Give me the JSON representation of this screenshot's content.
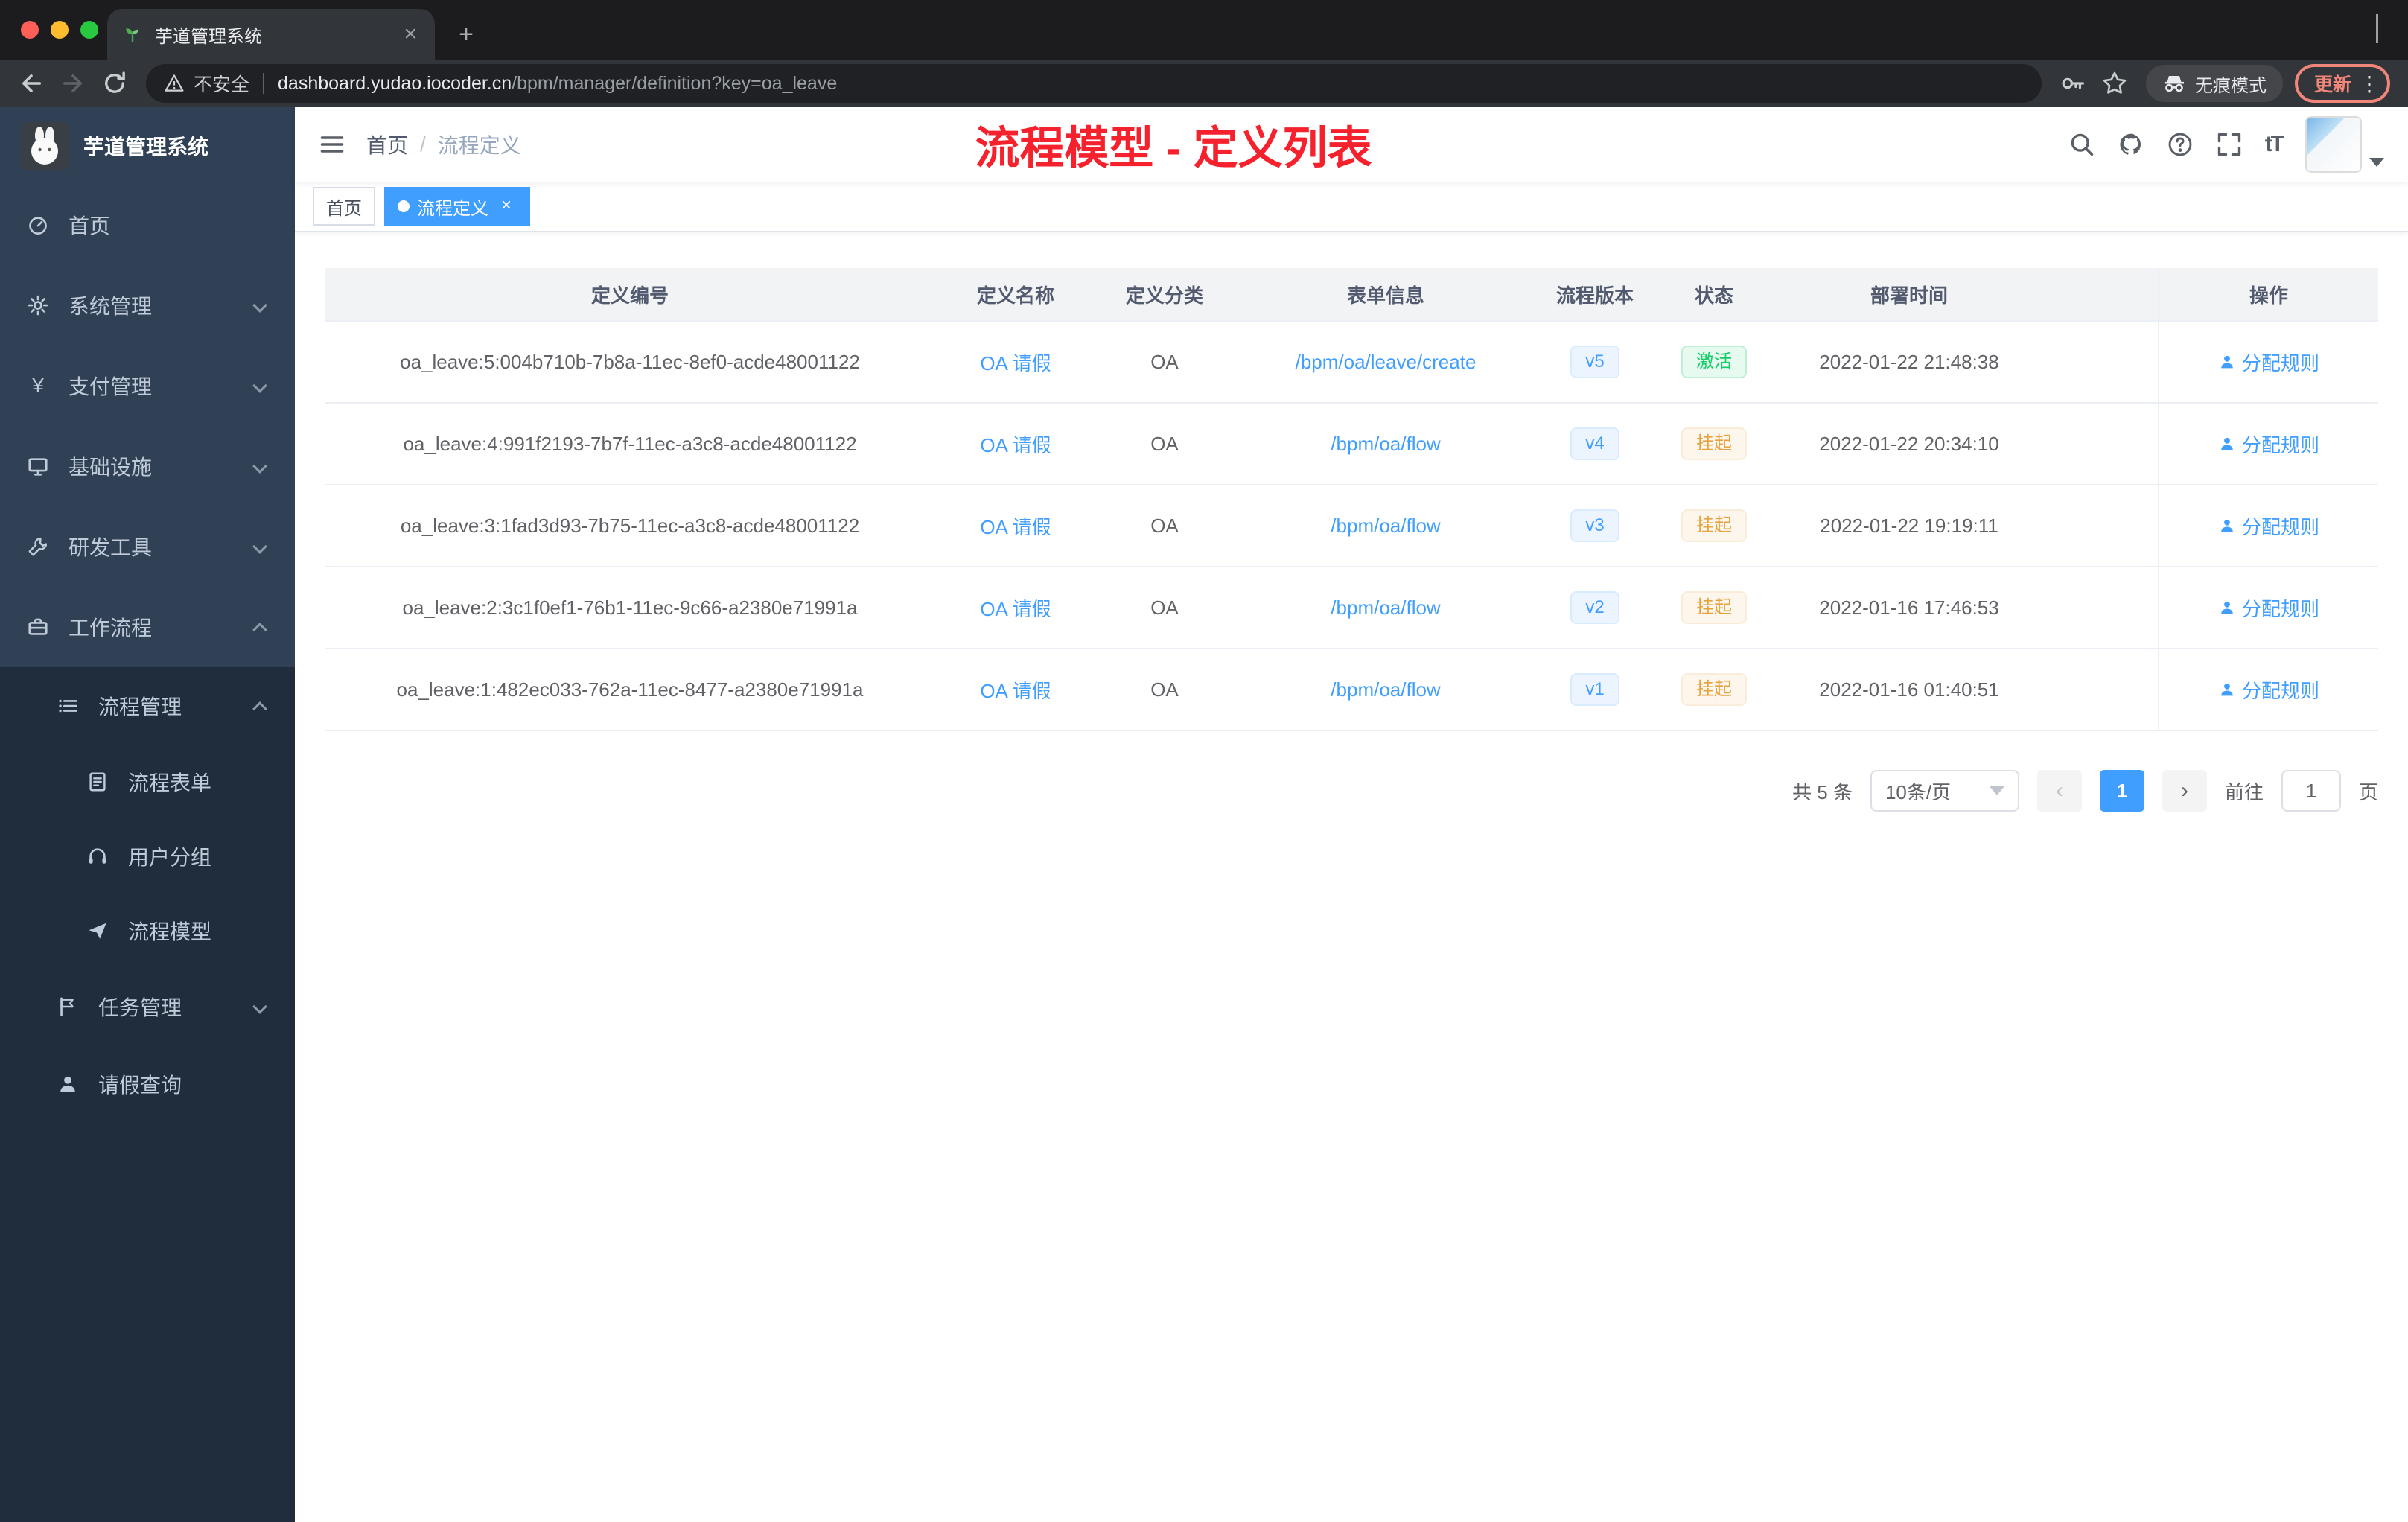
{
  "colors": {
    "accent": "#409eff",
    "annotation_red": "#f5222d",
    "sidebar_bg": "#304156",
    "sidebar_submenu_bg": "#1f2d3d",
    "status_active_green": "#13ce66",
    "status_suspend_orange": "#e6a23c",
    "update_pill_red": "#f08579"
  },
  "browser": {
    "tab_title": "芋道管理系统",
    "close_glyph": "×",
    "new_tab_glyph": "+",
    "security_label": "不安全",
    "url_host": "dashboard.yudao.iocoder.cn",
    "url_path": "/bpm/manager/definition?key=oa_leave",
    "incognito_label": "无痕模式",
    "update_label": "更新",
    "menu_dots": "⋮"
  },
  "sidebar": {
    "logo_title": "芋道管理系统",
    "items": [
      {
        "label": "首页"
      },
      {
        "label": "系统管理"
      },
      {
        "label": "支付管理"
      },
      {
        "label": "基础设施"
      },
      {
        "label": "研发工具"
      },
      {
        "label": "工作流程"
      }
    ],
    "process_group": {
      "label": "流程管理"
    },
    "process_children": [
      {
        "label": "流程表单"
      },
      {
        "label": "用户分组"
      },
      {
        "label": "流程模型"
      }
    ],
    "task_group": {
      "label": "任务管理"
    },
    "leave_item": {
      "label": "请假查询"
    },
    "yen_glyph": "¥"
  },
  "header": {
    "breadcrumb_home": "首页",
    "breadcrumb_separator": "/",
    "breadcrumb_current": "流程定义",
    "annotation_title": "流程模型 - 定义列表",
    "font_size_icon_text": "tT"
  },
  "tags": {
    "home": "首页",
    "current": "流程定义",
    "close_glyph": "×"
  },
  "table": {
    "columns": {
      "id": "定义编号",
      "name": "定义名称",
      "category": "定义分类",
      "form": "表单信息",
      "version": "流程版本",
      "status": "状态",
      "deploy_time": "部署时间",
      "actions": "操作"
    },
    "action_label": "分配规则",
    "rows": [
      {
        "id": "oa_leave:5:004b710b-7b8a-11ec-8ef0-acde48001122",
        "name": "OA 请假",
        "category": "OA",
        "form": "/bpm/oa/leave/create",
        "version": "v5",
        "status": "激活",
        "status_type": "success",
        "deploy_time": "2022-01-22 21:48:38"
      },
      {
        "id": "oa_leave:4:991f2193-7b7f-11ec-a3c8-acde48001122",
        "name": "OA 请假",
        "category": "OA",
        "form": "/bpm/oa/flow",
        "version": "v4",
        "status": "挂起",
        "status_type": "warning",
        "deploy_time": "2022-01-22 20:34:10"
      },
      {
        "id": "oa_leave:3:1fad3d93-7b75-11ec-a3c8-acde48001122",
        "name": "OA 请假",
        "category": "OA",
        "form": "/bpm/oa/flow",
        "version": "v3",
        "status": "挂起",
        "status_type": "warning",
        "deploy_time": "2022-01-22 19:19:11"
      },
      {
        "id": "oa_leave:2:3c1f0ef1-76b1-11ec-9c66-a2380e71991a",
        "name": "OA 请假",
        "category": "OA",
        "form": "/bpm/oa/flow",
        "version": "v2",
        "status": "挂起",
        "status_type": "warning",
        "deploy_time": "2022-01-16 17:46:53"
      },
      {
        "id": "oa_leave:1:482ec033-762a-11ec-8477-a2380e71991a",
        "name": "OA 请假",
        "category": "OA",
        "form": "/bpm/oa/flow",
        "version": "v1",
        "status": "挂起",
        "status_type": "warning",
        "deploy_time": "2022-01-16 01:40:51"
      }
    ]
  },
  "pagination": {
    "total": "共 5 条",
    "page_size": "10条/页",
    "prev_glyph": "‹",
    "current_page": "1",
    "next_glyph": "›",
    "goto_label": "前往",
    "goto_value": "1",
    "page_unit": "页"
  }
}
